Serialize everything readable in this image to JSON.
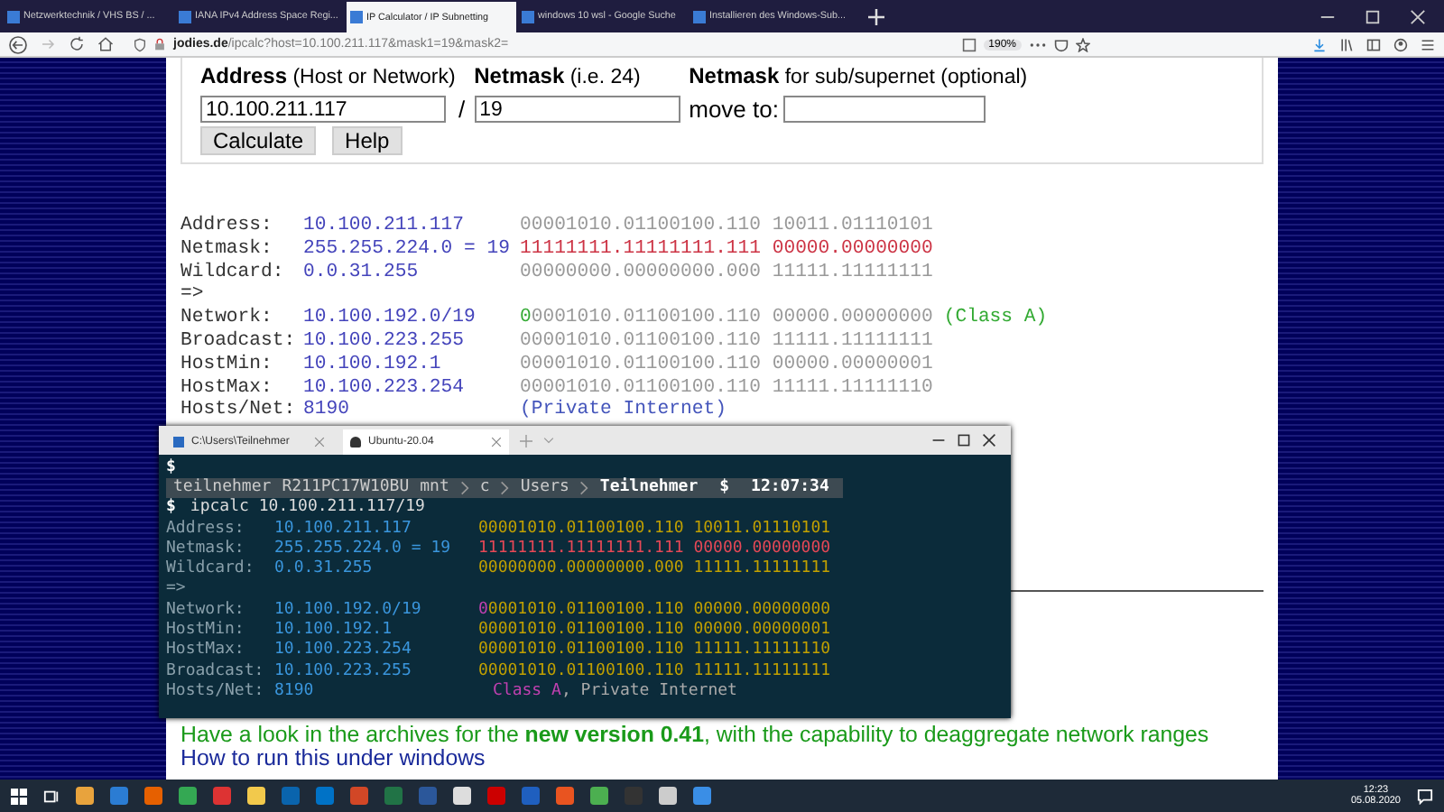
{
  "browser": {
    "tabs": [
      {
        "title": "Netzwerktechnik / VHS BS / ...",
        "selected": false
      },
      {
        "title": "IANA IPv4 Address Space Regi...",
        "selected": false
      },
      {
        "title": "IP Calculator / IP Subnetting",
        "selected": true
      },
      {
        "title": "windows 10 wsl - Google Suche",
        "selected": false
      },
      {
        "title": "Installieren des Windows-Sub...",
        "selected": false
      }
    ],
    "url_domain": "jodies.de",
    "url_path": "/ipcalc?host=10.100.211.117&mask1=19&mask2=",
    "zoom": "190%"
  },
  "form": {
    "headings": [
      "**Address** (Host or Network)",
      "**Netmask** (i.e. 24)",
      "**Netmask** for sub/supernet (optional)"
    ],
    "address": "10.100.211.117",
    "separator": "/",
    "netmask": "19",
    "move_label": "move to:",
    "buttons": [
      "Calculate",
      "Help"
    ]
  },
  "results": [
    {
      "label": "Address:",
      "value": "10.100.211.117",
      "binary": "00001010.01100100.110 10011.01110101",
      "kind": "address"
    },
    {
      "label": "Netmask:",
      "value": "255.255.224.0 = 19",
      "binary": "11111111.11111111.111 00000.00000000",
      "kind": "mask"
    },
    {
      "label": "Wildcard:",
      "value": "0.0.31.255",
      "binary": "00000000.00000000.000 11111.11111111",
      "kind": "address"
    },
    {
      "label": "=>",
      "kind": "separator"
    },
    {
      "label": "Network:",
      "value": "10.100.192.0/19",
      "binary": "00001010.01100100.110 00000.00000000",
      "kind": "network",
      "note": "(Class A)"
    },
    {
      "label": "Broadcast:",
      "value": "10.100.223.255",
      "binary": "00001010.01100100.110 11111.11111111",
      "kind": "address"
    },
    {
      "label": "HostMin:",
      "value": "10.100.192.1",
      "binary": "00001010.01100100.110 00000.00000001",
      "kind": "address"
    },
    {
      "label": "HostMax:",
      "value": "10.100.223.254",
      "binary": "00001010.01100100.110 11111.11111110",
      "kind": "address"
    },
    {
      "label": "Hosts/Net:",
      "value": "8190",
      "binary": "(Private Internet)",
      "kind": "info"
    }
  ],
  "terminal": {
    "tabs": [
      {
        "title": "C:\\Users\\Teilnehmer",
        "selected": false
      },
      {
        "title": "Ubuntu-20.04",
        "selected": true
      }
    ],
    "first_prompt": "$",
    "segments": [
      "teilnehmer",
      "R211PC17W10BU",
      "mnt",
      "c",
      "Users",
      "Teilnehmer"
    ],
    "prompt_symbol": "$",
    "time": "12:07:34",
    "command_prompt": "$",
    "command": "ipcalc 10.100.211.117/19",
    "rows": [
      {
        "label": "Address:",
        "value": "10.100.211.117",
        "binary": "00001010.01100100.110 10011.01110101",
        "kind": "address"
      },
      {
        "label": "Netmask:",
        "value": "255.255.224.0 = 19",
        "binary": "11111111.11111111.111 00000.00000000",
        "kind": "mask"
      },
      {
        "label": "Wildcard:",
        "value": "0.0.31.255",
        "binary": "00000000.00000000.000 11111.11111111",
        "kind": "address"
      },
      {
        "label": "=>",
        "kind": "separator"
      },
      {
        "label": "Network:",
        "value": "10.100.192.0/19",
        "binary": "00001010.01100100.110 00000.00000000",
        "kind": "network"
      },
      {
        "label": "HostMin:",
        "value": "10.100.192.1",
        "binary": "00001010.01100100.110 00000.00000001",
        "kind": "address"
      },
      {
        "label": "HostMax:",
        "value": "10.100.223.254",
        "binary": "00001010.01100100.110 11111.11111110",
        "kind": "address"
      },
      {
        "label": "Broadcast:",
        "value": "10.100.223.255",
        "binary": "00001010.01100100.110 11111.11111111",
        "kind": "address"
      },
      {
        "label": "Hosts/Net:",
        "value": "8190",
        "class_note": "Class A",
        "rest_note": ", Private Internet",
        "kind": "info"
      }
    ]
  },
  "footer": {
    "archive_text": "Have a look in the archives for the **new version 0.41**, with the capability to deaggregate network ranges",
    "windows_link": "How to run this under windows"
  },
  "taskbar": {
    "time": "12:23",
    "date": "05.08.2020"
  }
}
